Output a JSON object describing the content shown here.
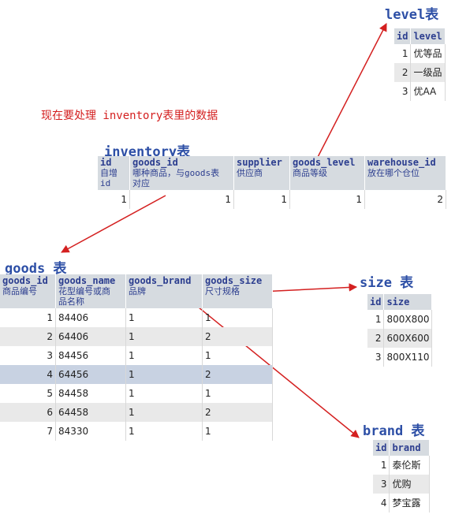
{
  "titles": {
    "level": "level表",
    "inventory": "inventory表",
    "goods": "goods 表",
    "size": "size 表",
    "brand": "brand 表"
  },
  "note": "现在要处理 inventory表里的数据",
  "level_table": {
    "headers": [
      "id",
      "level"
    ],
    "rows": [
      [
        "1",
        "优等品"
      ],
      [
        "2",
        "一级品"
      ],
      [
        "3",
        "优AA"
      ]
    ]
  },
  "inventory_table": {
    "headers": [
      {
        "name": "id",
        "desc1": "自增",
        "desc2": "id"
      },
      {
        "name": "goods_id",
        "desc1": "哪种商品，与goods表",
        "desc2": "对应"
      },
      {
        "name": "supplier",
        "desc1": "供应商",
        "desc2": ""
      },
      {
        "name": "goods_level",
        "desc1": "商品等级",
        "desc2": ""
      },
      {
        "name": "warehouse_id",
        "desc1": "放在哪个仓位",
        "desc2": ""
      }
    ],
    "rows": [
      [
        "1",
        "1",
        "1",
        "1",
        "2"
      ]
    ]
  },
  "goods_table": {
    "headers": [
      {
        "name": "goods_id",
        "desc1": "商品编号",
        "desc2": ""
      },
      {
        "name": "goods_name",
        "desc1": "花型编号或商",
        "desc2": "品名称"
      },
      {
        "name": "goods_brand",
        "desc1": "品牌",
        "desc2": ""
      },
      {
        "name": "goods_size",
        "desc1": "尺寸规格",
        "desc2": ""
      }
    ],
    "rows": [
      [
        "1",
        "84406",
        "1",
        "1"
      ],
      [
        "2",
        "64406",
        "1",
        "2"
      ],
      [
        "3",
        "84456",
        "1",
        "1"
      ],
      [
        "4",
        "64456",
        "1",
        "2"
      ],
      [
        "5",
        "84458",
        "1",
        "1"
      ],
      [
        "6",
        "64458",
        "1",
        "2"
      ],
      [
        "7",
        "84330",
        "1",
        "1"
      ]
    ]
  },
  "size_table": {
    "headers": [
      "id",
      "size"
    ],
    "rows": [
      [
        "1",
        "800X800"
      ],
      [
        "2",
        "600X600"
      ],
      [
        "3",
        "800X110"
      ]
    ]
  },
  "brand_table": {
    "headers": [
      "id",
      "brand"
    ],
    "rows": [
      [
        "1",
        "泰伦斯"
      ],
      [
        "3",
        "优购"
      ],
      [
        "4",
        "梦宝露"
      ]
    ]
  },
  "colors": {
    "arrow": "#d42020",
    "title": "#2d4fa6",
    "header_bg": "#d6dbe0",
    "selected_row": "#c8d2e2"
  }
}
